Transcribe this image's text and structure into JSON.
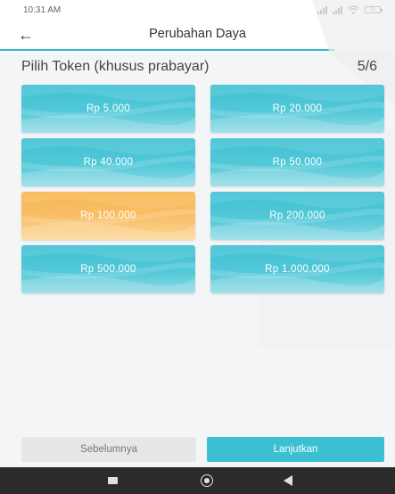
{
  "status_bar": {
    "time": "10:31 AM",
    "battery_level": "35",
    "icons": [
      "signal-icon",
      "signal-icon",
      "wifi-icon",
      "battery-icon"
    ]
  },
  "app_bar": {
    "back_icon": "arrow-left-icon",
    "title": "Perubahan Daya"
  },
  "section": {
    "title": "Pilih Token (khusus prabayar)",
    "step": "5/6"
  },
  "tokens": [
    {
      "label": "Rp 5.000",
      "selected": false
    },
    {
      "label": "Rp 20.000",
      "selected": false
    },
    {
      "label": "Rp 40.000",
      "selected": false
    },
    {
      "label": "Rp 50.000",
      "selected": false
    },
    {
      "label": "Rp 100.000",
      "selected": true
    },
    {
      "label": "Rp 200.000",
      "selected": false
    },
    {
      "label": "Rp 500.000",
      "selected": false
    },
    {
      "label": "Rp 1.000.000",
      "selected": false
    }
  ],
  "buttons": {
    "previous": "Sebelumnya",
    "next": "Lanjutkan"
  },
  "nav_bar": {
    "icons": [
      "recent-apps-icon",
      "home-icon",
      "back-icon"
    ]
  },
  "colors": {
    "accent": "#3cbfd1",
    "selected": "#f9bf66",
    "nav_bar": "#2b2b2b"
  }
}
